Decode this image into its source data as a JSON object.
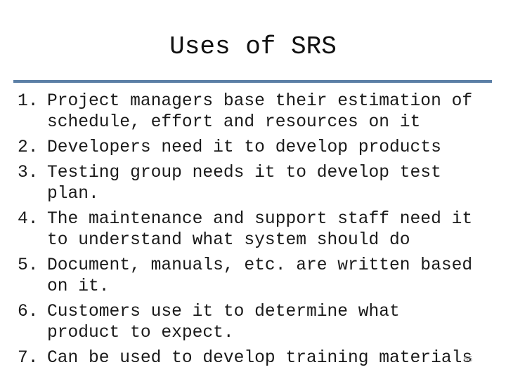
{
  "slide": {
    "title": "Uses of SRS",
    "accent_color": "#5b7fa6",
    "slide_number": "65",
    "items": [
      {
        "num": "1.",
        "lines": [
          "Project managers base their estimation of",
          "schedule, effort and resources on it"
        ]
      },
      {
        "num": "2.",
        "lines": [
          "Developers need it to develop products"
        ]
      },
      {
        "num": "3.",
        "lines": [
          "Testing group needs it to develop test",
          "plan."
        ]
      },
      {
        "num": "4.",
        "lines": [
          "The maintenance and support staff need it",
          "to understand what system should do"
        ]
      },
      {
        "num": "5.",
        "lines": [
          "Document, manuals, etc. are written based",
          "on it."
        ]
      },
      {
        "num": "6.",
        "lines": [
          "Customers use it to determine what",
          "product to expect."
        ]
      },
      {
        "num": "7.",
        "lines": [
          "Can be used to develop training materials"
        ]
      }
    ]
  }
}
